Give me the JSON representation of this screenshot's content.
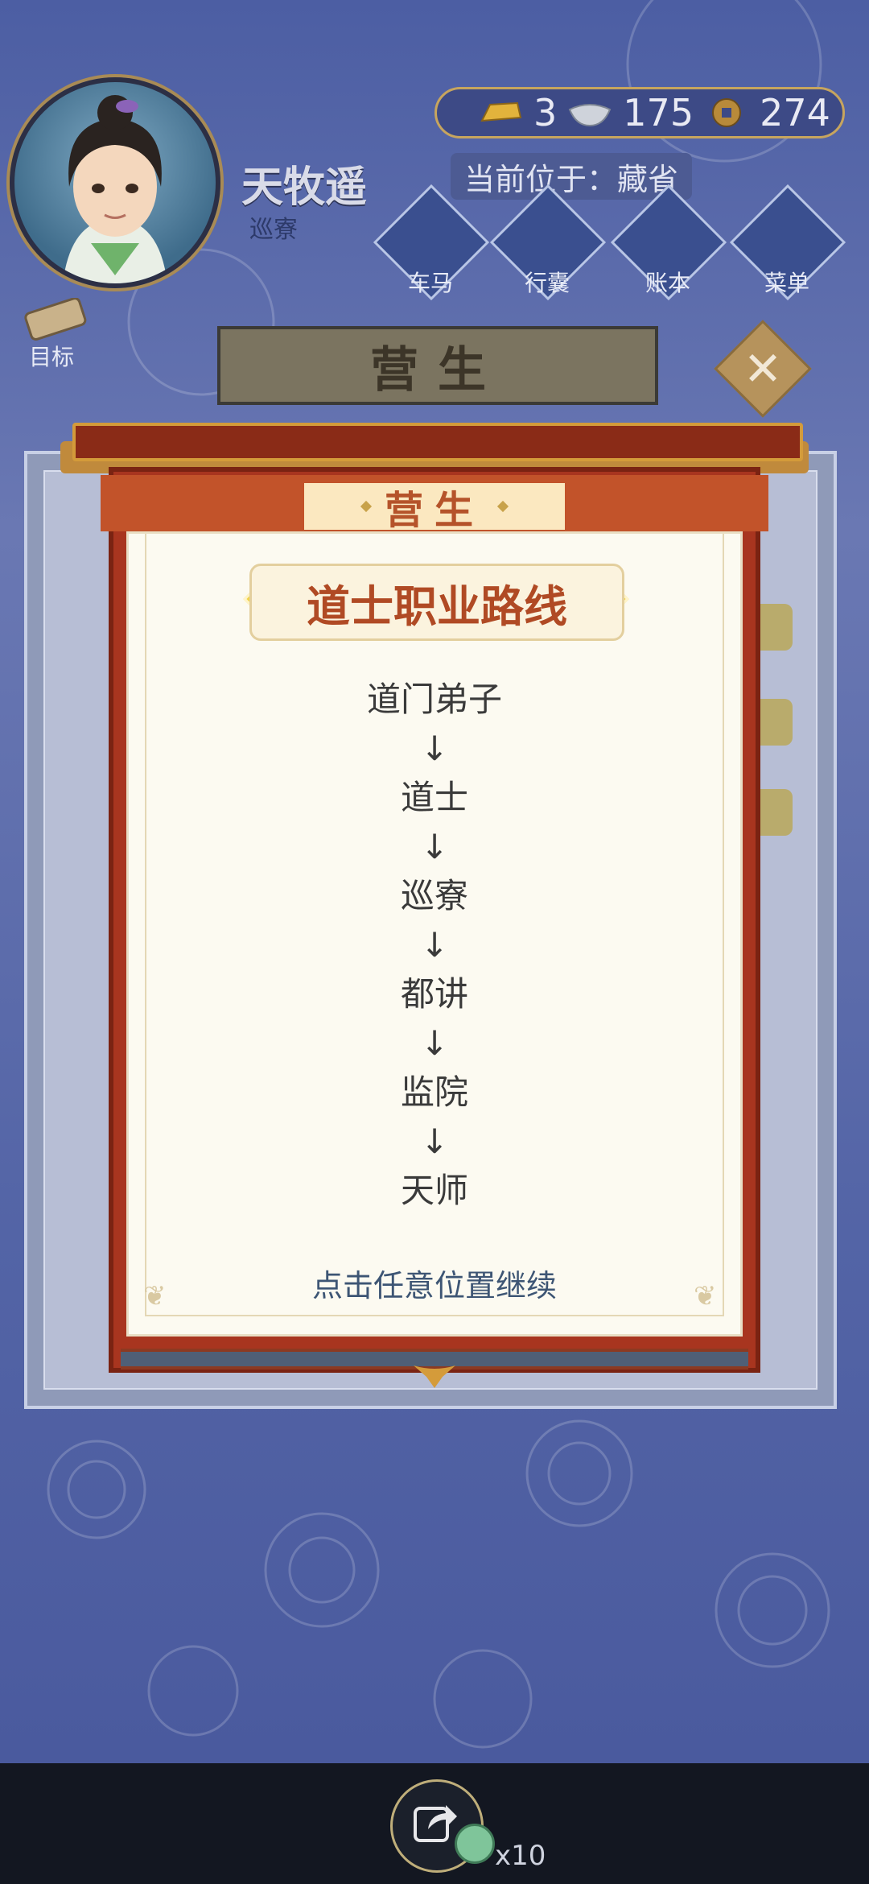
{
  "player": {
    "name": "天牧遥",
    "rank": "巡寮"
  },
  "currency": {
    "gold": "3",
    "silver": "175",
    "copper": "274"
  },
  "location": {
    "text": "当前位于：藏省"
  },
  "nav": [
    {
      "label": "车马"
    },
    {
      "label": "行囊"
    },
    {
      "label": "账本"
    },
    {
      "label": "菜单"
    }
  ],
  "goal": {
    "label": "目标"
  },
  "background_panel": {
    "header": "营生"
  },
  "modal": {
    "tag": "营生",
    "title": "道士职业路线",
    "path": [
      "道门弟子",
      "道士",
      "巡寮",
      "都讲",
      "监院",
      "天师"
    ],
    "arrow": "↓",
    "hint": "点击任意位置继续"
  },
  "bottom": {
    "multiplier": "x10"
  },
  "colors": {
    "frame_red": "#a8351f",
    "title_brown": "#b04a24",
    "paper": "#fcfaf1"
  }
}
